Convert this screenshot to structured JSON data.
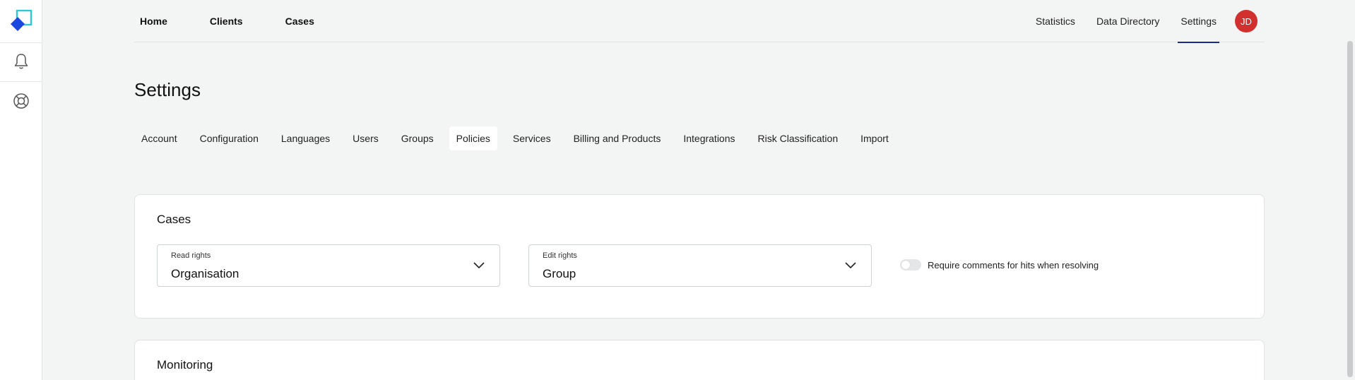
{
  "nav": {
    "left": [
      "Home",
      "Clients",
      "Cases"
    ],
    "right": [
      "Statistics",
      "Data Directory",
      "Settings"
    ],
    "active_right": "Settings",
    "avatar_initials": "JD"
  },
  "page": {
    "title": "Settings"
  },
  "tabs": [
    "Account",
    "Configuration",
    "Languages",
    "Users",
    "Groups",
    "Policies",
    "Services",
    "Billing and Products",
    "Integrations",
    "Risk Classification",
    "Import"
  ],
  "active_tab": "Policies",
  "cases_card": {
    "title": "Cases",
    "read_rights": {
      "label": "Read rights",
      "value": "Organisation"
    },
    "edit_rights": {
      "label": "Edit rights",
      "value": "Group"
    },
    "require_comments": {
      "label": "Require comments for hits when resolving",
      "enabled": false
    }
  },
  "monitoring_card": {
    "title": "Monitoring"
  },
  "colors": {
    "accent": "#1a2a8a",
    "avatar_bg": "#d22f2f",
    "background": "#f3f4f4"
  },
  "icons": {
    "logo": "app-logo",
    "notifications": "bell-icon",
    "support": "lifebuoy-icon"
  }
}
